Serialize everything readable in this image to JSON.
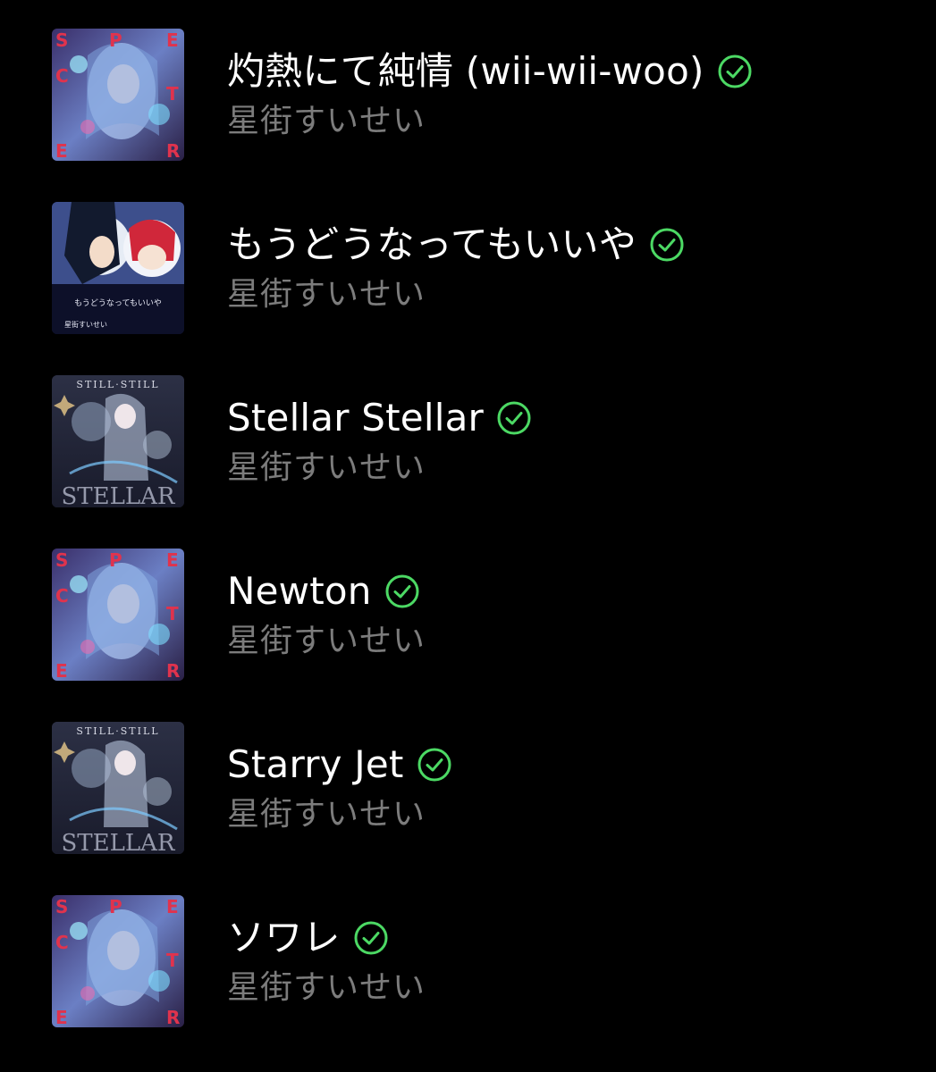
{
  "colors": {
    "background": "#000000",
    "title": "#ffffff",
    "artist": "#7c7c7c",
    "downloaded_check": "#4cd964"
  },
  "tracks": [
    {
      "title": "灼熱にて純情 (wii-wii-woo)",
      "artist": "星街すいせい",
      "downloaded_icon": "check-circle-icon",
      "cover": "specter-album-art"
    },
    {
      "title": "もうどうなってもいいや",
      "artist": "星街すいせい",
      "downloaded_icon": "check-circle-icon",
      "cover": "mou-dou-natte-mo-ii-ya-single-art",
      "cover_text": "もうどうなってもいいや",
      "cover_artist_text": "星街すいせい"
    },
    {
      "title": "Stellar Stellar",
      "artist": "星街すいせい",
      "downloaded_icon": "check-circle-icon",
      "cover": "still-still-stellar-album-art"
    },
    {
      "title": "Newton",
      "artist": "星街すいせい",
      "downloaded_icon": "check-circle-icon",
      "cover": "specter-album-art"
    },
    {
      "title": "Starry Jet",
      "artist": "星街すいせい",
      "downloaded_icon": "check-circle-icon",
      "cover": "still-still-stellar-album-art"
    },
    {
      "title": "ソワレ",
      "artist": "星街すいせい",
      "downloaded_icon": "check-circle-icon",
      "cover": "specter-album-art"
    }
  ],
  "album_art_text": {
    "specter": [
      "S",
      "P",
      "E",
      "C",
      "T",
      "E",
      "R"
    ],
    "still_stellar_top": "STILL·STILL",
    "still_stellar_bottom": "STELLAR"
  }
}
